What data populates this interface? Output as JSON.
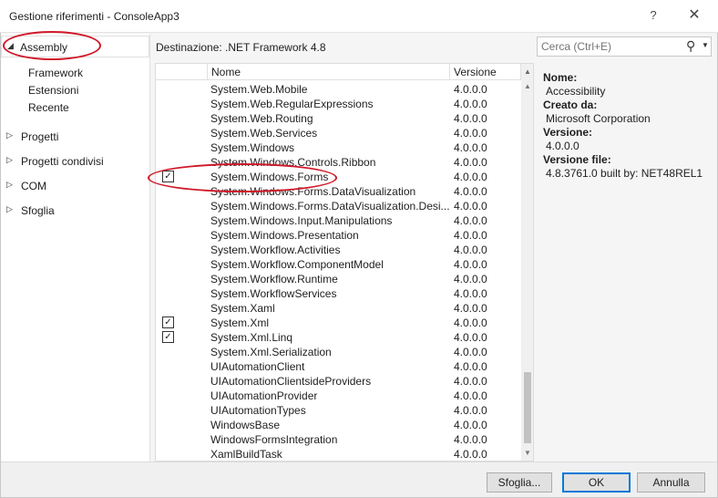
{
  "window": {
    "title": "Gestione riferimenti - ConsoleApp3",
    "help_label": "?",
    "close_label": "✕"
  },
  "sidebar": {
    "items": [
      {
        "label": "Assembly",
        "arrow": "◢"
      },
      {
        "label": "Framework"
      },
      {
        "label": "Estensioni"
      },
      {
        "label": "Recente"
      },
      {
        "label": "Progetti",
        "arrow": "▷"
      },
      {
        "label": "Progetti condivisi",
        "arrow": "▷"
      },
      {
        "label": "COM",
        "arrow": "▷"
      },
      {
        "label": "Sfoglia",
        "arrow": "▷"
      }
    ]
  },
  "target": {
    "label": "Destinazione: .NET Framework 4.8"
  },
  "search": {
    "placeholder": "Cerca (Ctrl+E)",
    "icon": "search-icon"
  },
  "table": {
    "columns": {
      "name": "Nome",
      "version": "Versione"
    },
    "rows": [
      {
        "name": "System.Web.Mobile",
        "version": "4.0.0.0",
        "checked": false
      },
      {
        "name": "System.Web.RegularExpressions",
        "version": "4.0.0.0",
        "checked": false
      },
      {
        "name": "System.Web.Routing",
        "version": "4.0.0.0",
        "checked": false
      },
      {
        "name": "System.Web.Services",
        "version": "4.0.0.0",
        "checked": false
      },
      {
        "name": "System.Windows",
        "version": "4.0.0.0",
        "checked": false
      },
      {
        "name": "System.Windows.Controls.Ribbon",
        "version": "4.0.0.0",
        "checked": false
      },
      {
        "name": "System.Windows.Forms",
        "version": "4.0.0.0",
        "checked": true
      },
      {
        "name": "System.Windows.Forms.DataVisualization",
        "version": "4.0.0.0",
        "checked": false
      },
      {
        "name": "System.Windows.Forms.DataVisualization.Desi...",
        "version": "4.0.0.0",
        "checked": false
      },
      {
        "name": "System.Windows.Input.Manipulations",
        "version": "4.0.0.0",
        "checked": false
      },
      {
        "name": "System.Windows.Presentation",
        "version": "4.0.0.0",
        "checked": false
      },
      {
        "name": "System.Workflow.Activities",
        "version": "4.0.0.0",
        "checked": false
      },
      {
        "name": "System.Workflow.ComponentModel",
        "version": "4.0.0.0",
        "checked": false
      },
      {
        "name": "System.Workflow.Runtime",
        "version": "4.0.0.0",
        "checked": false
      },
      {
        "name": "System.WorkflowServices",
        "version": "4.0.0.0",
        "checked": false
      },
      {
        "name": "System.Xaml",
        "version": "4.0.0.0",
        "checked": false
      },
      {
        "name": "System.Xml",
        "version": "4.0.0.0",
        "checked": true
      },
      {
        "name": "System.Xml.Linq",
        "version": "4.0.0.0",
        "checked": true
      },
      {
        "name": "System.Xml.Serialization",
        "version": "4.0.0.0",
        "checked": false
      },
      {
        "name": "UIAutomationClient",
        "version": "4.0.0.0",
        "checked": false
      },
      {
        "name": "UIAutomationClientsideProviders",
        "version": "4.0.0.0",
        "checked": false
      },
      {
        "name": "UIAutomationProvider",
        "version": "4.0.0.0",
        "checked": false
      },
      {
        "name": "UIAutomationTypes",
        "version": "4.0.0.0",
        "checked": false
      },
      {
        "name": "WindowsBase",
        "version": "4.0.0.0",
        "checked": false
      },
      {
        "name": "WindowsFormsIntegration",
        "version": "4.0.0.0",
        "checked": false
      },
      {
        "name": "XamlBuildTask",
        "version": "4.0.0.0",
        "checked": false
      }
    ]
  },
  "details": {
    "name_label": "Nome:",
    "name_value": "Accessibility",
    "created_label": "Creato da:",
    "created_value": "Microsoft Corporation",
    "version_label": "Versione:",
    "version_value": "4.0.0.0",
    "file_version_label": "Versione file:",
    "file_version_value": "4.8.3761.0 built by: NET48REL1"
  },
  "buttons": {
    "browse": "Sfoglia...",
    "ok": "OK",
    "cancel": "Annulla"
  },
  "colors": {
    "annotation_red": "#d01828",
    "accent_blue": "#0078d7"
  }
}
